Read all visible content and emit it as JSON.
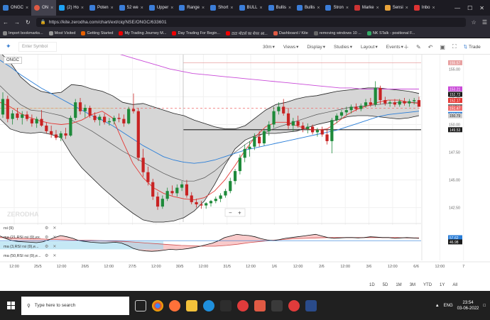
{
  "browser": {
    "tabs": [
      {
        "label": "ONGC",
        "color": "#387ed1",
        "ball": false,
        "active": false
      },
      {
        "label": "ON",
        "color": "#e05a44",
        "ball": true,
        "active": true
      },
      {
        "label": "(2) Ho",
        "color": "#1da1f2",
        "ball": false,
        "active": false
      },
      {
        "label": "Poten",
        "color": "#3b7dd8",
        "ball": false,
        "active": false
      },
      {
        "label": "52 we",
        "color": "#3b7dd8",
        "ball": false,
        "active": false
      },
      {
        "label": "Upper",
        "color": "#3b7dd8",
        "ball": false,
        "active": false
      },
      {
        "label": "Range",
        "color": "#3b7dd8",
        "ball": false,
        "active": false
      },
      {
        "label": "Short",
        "color": "#3b7dd8",
        "ball": false,
        "active": false
      },
      {
        "label": "BULL",
        "color": "#3b7dd8",
        "ball": false,
        "active": false
      },
      {
        "label": "Bullis",
        "color": "#3b7dd8",
        "ball": false,
        "active": false
      },
      {
        "label": "Bullis",
        "color": "#3b7dd8",
        "ball": false,
        "active": false
      },
      {
        "label": "Stron",
        "color": "#3b7dd8",
        "ball": false,
        "active": false
      },
      {
        "label": "Marke",
        "color": "#c33",
        "ball": false,
        "active": false
      },
      {
        "label": "Sensi",
        "color": "#e8a33a",
        "ball": false,
        "active": false
      },
      {
        "label": "Inbo",
        "color": "#d33",
        "ball": false,
        "active": false
      }
    ],
    "url": "https://kite.zerodha.com/chart/ext/ciq/NSE/ONGC/633601",
    "bookmarks": [
      {
        "label": "Import bookmarks...",
        "color": "#888"
      },
      {
        "label": "Most Visited",
        "color": "#999"
      },
      {
        "label": "Getting Started",
        "color": "#e66000"
      },
      {
        "label": "My Trading Journey M...",
        "color": "#e00"
      },
      {
        "label": "Day Trading For Begin...",
        "color": "#e00"
      },
      {
        "label": "टाटा मोटर्स का शेयर आ...",
        "color": "#e00"
      },
      {
        "label": "Dashboard / Kite",
        "color": "#e05a44"
      },
      {
        "label": "removing windows 10 ...",
        "color": "#666"
      },
      {
        "label": "NK STalk - positional F...",
        "color": "#3a6"
      }
    ]
  },
  "toolbar": {
    "search_placeholder": "Enter Symbol",
    "interval": "30m",
    "views": "Views",
    "display": "Display",
    "studies": "Studies",
    "layout": "Layout",
    "events": "Events",
    "trade": "Trade"
  },
  "symbol": "ONGC",
  "watermark": "ZERODHA",
  "indicators": [
    "rsi (9)",
    "ma (21,RSI rsi (9),ex...",
    "ma (3,RSI rsi (9),e...",
    "ma (50,RSI rsi (9),e..."
  ],
  "ranges": [
    "1D",
    "5D",
    "1M",
    "3M",
    "YTD",
    "1Y",
    "All"
  ],
  "taskbar": {
    "search_placeholder": "Type here to search",
    "lang": "ENG",
    "time": "23:54",
    "date": "03-06-2022"
  },
  "chart_data": {
    "type": "candlestick",
    "symbol": "ONGC",
    "interval": "30m",
    "ylim": [
      141.2,
      156.3
    ],
    "price_ticks": [
      155.0,
      152.5,
      150.0,
      147.5,
      145.0,
      142.5
    ],
    "price_labels": [
      {
        "value": 155.57,
        "color": "#e8a0a0"
      },
      {
        "value": 153.21,
        "color": "#c94ad8"
      },
      {
        "value": 152.72,
        "color": "#1a1a1a"
      },
      {
        "value": 152.17,
        "color": "#e53935"
      },
      {
        "value": 151.6,
        "color": "#777777"
      },
      {
        "value": 151.47,
        "color": "#ef6c6c"
      },
      {
        "value": 150.91,
        "color": "#2a7ed8"
      },
      {
        "value": 149.53,
        "color": "#1a1a1a"
      },
      {
        "value": 150.79,
        "color": "#cccccc"
      }
    ],
    "horizontal_levels": [
      155.57,
      149.53,
      151.47
    ],
    "x_labels": [
      "12:00",
      "25/5",
      "12:00",
      "26/5",
      "12:00",
      "27/5",
      "12:00",
      "30/5",
      "12:00",
      "31/5",
      "12:00",
      "1/6",
      "12:00",
      "2/6",
      "12:00",
      "3/6",
      "12:00",
      "6/6",
      "12:00",
      "7"
    ],
    "candles": [
      [
        150.9,
        152.9,
        150.6,
        152.3
      ],
      [
        152.3,
        152.6,
        150.2,
        150.5
      ],
      [
        150.5,
        151.3,
        150.0,
        151.0
      ],
      [
        151.0,
        151.5,
        150.4,
        150.6
      ],
      [
        150.6,
        151.2,
        150.0,
        150.9
      ],
      [
        150.9,
        151.2,
        150.3,
        150.5
      ],
      [
        150.5,
        150.9,
        149.8,
        150.1
      ],
      [
        150.1,
        150.7,
        149.7,
        150.5
      ],
      [
        150.5,
        151.3,
        149.8,
        149.9
      ],
      [
        149.9,
        150.2,
        149.2,
        149.4
      ],
      [
        149.4,
        149.9,
        148.8,
        149.1
      ],
      [
        149.1,
        149.5,
        148.6,
        148.8
      ],
      [
        148.8,
        149.4,
        148.5,
        149.2
      ],
      [
        149.2,
        149.7,
        148.7,
        149.0
      ],
      [
        149.0,
        150.8,
        148.9,
        150.6
      ],
      [
        150.6,
        152.3,
        150.4,
        152.0
      ],
      [
        152.0,
        152.4,
        150.9,
        151.2
      ],
      [
        151.2,
        151.8,
        150.6,
        151.5
      ],
      [
        151.5,
        151.7,
        150.6,
        150.8
      ],
      [
        150.8,
        151.1,
        150.2,
        150.4
      ],
      [
        150.4,
        150.9,
        149.9,
        150.7
      ],
      [
        150.7,
        151.0,
        150.0,
        150.2
      ],
      [
        150.2,
        150.6,
        149.9,
        150.3
      ],
      [
        150.3,
        150.8,
        150.0,
        150.6
      ],
      [
        150.6,
        151.0,
        150.2,
        150.5
      ],
      [
        150.5,
        150.9,
        149.8,
        150.1
      ],
      [
        150.1,
        151.6,
        150.0,
        151.4
      ],
      [
        151.4,
        152.8,
        151.0,
        151.2
      ],
      [
        151.2,
        151.5,
        146.7,
        147.0
      ],
      [
        147.0,
        147.8,
        145.3,
        145.7
      ],
      [
        145.7,
        146.2,
        144.5,
        144.8
      ],
      [
        144.8,
        145.1,
        143.2,
        143.5
      ],
      [
        143.5,
        143.9,
        142.3,
        142.6
      ],
      [
        142.6,
        143.6,
        142.4,
        143.3
      ],
      [
        143.3,
        144.3,
        143.1,
        144.0
      ],
      [
        144.0,
        144.5,
        143.6,
        143.8
      ],
      [
        143.8,
        144.6,
        143.5,
        144.3
      ],
      [
        144.3,
        144.9,
        144.0,
        144.6
      ],
      [
        144.6,
        145.0,
        143.4,
        143.6
      ],
      [
        143.6,
        143.9,
        142.8,
        143.0
      ],
      [
        143.0,
        143.3,
        142.5,
        142.8
      ],
      [
        142.8,
        143.1,
        142.4,
        142.7
      ],
      [
        142.7,
        143.0,
        142.4,
        142.9
      ],
      [
        142.9,
        143.2,
        142.6,
        143.1
      ],
      [
        143.1,
        143.5,
        142.9,
        143.3
      ],
      [
        143.3,
        143.8,
        143.0,
        143.6
      ],
      [
        143.6,
        144.2,
        143.4,
        144.0
      ],
      [
        144.0,
        145.2,
        143.8,
        144.9
      ],
      [
        144.9,
        146.0,
        144.6,
        145.8
      ],
      [
        145.8,
        147.3,
        145.5,
        147.0
      ],
      [
        147.0,
        148.2,
        146.6,
        147.8
      ],
      [
        147.8,
        148.5,
        147.1,
        148.0
      ],
      [
        148.0,
        149.2,
        147.7,
        148.9
      ],
      [
        148.9,
        149.4,
        148.0,
        148.3
      ],
      [
        148.3,
        149.6,
        148.1,
        149.4
      ],
      [
        149.4,
        150.3,
        149.0,
        150.0
      ],
      [
        150.0,
        151.6,
        149.7,
        151.2
      ],
      [
        151.2,
        152.0,
        150.9,
        151.6
      ],
      [
        151.6,
        152.3,
        150.8,
        151.0
      ],
      [
        151.0,
        151.5,
        149.6,
        149.9
      ],
      [
        149.9,
        150.6,
        149.4,
        150.3
      ],
      [
        150.3,
        150.8,
        149.7,
        149.9
      ],
      [
        149.9,
        150.2,
        149.3,
        149.6
      ],
      [
        149.6,
        150.1,
        149.2,
        149.8
      ],
      [
        149.8,
        150.0,
        149.1,
        149.3
      ],
      [
        149.3,
        149.7,
        148.9,
        149.5
      ],
      [
        149.5,
        149.8,
        148.9,
        149.1
      ],
      [
        149.1,
        149.6,
        148.2,
        148.5
      ],
      [
        148.5,
        150.6,
        147.4,
        150.4
      ],
      [
        150.4,
        151.0,
        150.1,
        150.8
      ],
      [
        150.8,
        151.3,
        150.5,
        151.1
      ],
      [
        151.1,
        151.6,
        150.8,
        151.3
      ],
      [
        151.3,
        151.8,
        151.0,
        151.6
      ],
      [
        151.6,
        151.9,
        151.2,
        151.4
      ],
      [
        151.4,
        151.9,
        151.2,
        151.7
      ],
      [
        151.7,
        152.3,
        151.5,
        152.0
      ],
      [
        152.0,
        152.4,
        151.6,
        151.8
      ],
      [
        151.8,
        153.9,
        151.6,
        153.3
      ],
      [
        153.3,
        153.5,
        151.8,
        152.2
      ],
      [
        152.2,
        152.5,
        151.7,
        151.9
      ],
      [
        151.9,
        152.2,
        151.6,
        152.0
      ],
      [
        152.0,
        152.3,
        151.6,
        151.8
      ],
      [
        151.8,
        152.3,
        151.6,
        152.1
      ],
      [
        152.1,
        152.4,
        151.7,
        151.9
      ],
      [
        151.9,
        152.3,
        151.6,
        152.1
      ],
      [
        152.1,
        152.4,
        151.8,
        152.2
      ],
      [
        152.2,
        152.5,
        151.6,
        151.6
      ]
    ],
    "bollinger_upper": [
      156.5,
      155.6,
      154.3,
      153.5,
      153.0,
      152.8,
      152.9,
      153.6,
      153.5,
      153.2,
      153.0,
      152.6,
      152.0,
      151.8,
      151.9,
      151.6,
      151.3,
      151.0,
      150.8,
      150.4,
      150.1,
      149.8,
      149.6,
      149.6,
      149.9,
      150.6,
      151.3,
      151.8,
      152.0,
      152.3,
      152.5,
      152.6,
      152.8,
      153.0,
      153.1,
      153.2,
      153.3,
      153.3,
      153.2,
      153.1,
      153.0,
      152.8
    ],
    "bollinger_middle": [
      153.5,
      152.6,
      151.8,
      151.3,
      151.2,
      151.0,
      150.8,
      150.4,
      149.9,
      149.4,
      148.8,
      148.2,
      147.6,
      147.1,
      146.6,
      146.1,
      145.6,
      145.2,
      144.9,
      144.9,
      145.2,
      145.8,
      146.6,
      147.5,
      148.2,
      148.8,
      149.3,
      149.7,
      150.0,
      150.3,
      150.6,
      150.9,
      151.1,
      151.3,
      151.5,
      151.6,
      151.7,
      151.8,
      151.9,
      152.0,
      152.0,
      152.0
    ],
    "bollinger_lower": [
      150.5,
      149.6,
      149.3,
      149.2,
      149.3,
      149.1,
      148.8,
      147.3,
      146.1,
      145.2,
      144.3,
      143.5,
      142.7,
      142.0,
      141.4,
      141.2,
      141.2,
      141.3,
      141.6,
      142.2,
      143.1,
      144.6,
      146.3,
      147.8,
      148.6,
      149.0,
      149.2,
      149.2,
      149.3,
      149.4,
      149.7,
      150.0,
      150.2,
      150.4,
      150.7,
      150.8,
      150.8,
      150.7,
      150.6,
      150.5,
      150.6,
      150.8
    ],
    "ma_red": [
      152.0,
      151.6,
      151.0,
      150.6,
      150.3,
      150.1,
      150.0,
      150.1,
      150.4,
      150.9,
      151.2,
      150.6,
      148.5,
      146.5,
      145.2,
      144.3,
      143.8,
      143.5,
      143.3,
      143.2,
      143.4,
      144.0,
      145.0,
      146.3,
      147.7,
      148.9,
      149.8,
      150.2,
      150.2,
      149.9,
      149.6,
      149.5,
      149.6,
      150.2,
      150.9,
      151.4,
      151.7,
      152.0,
      152.2,
      152.2,
      152.0,
      151.9
    ],
    "ma_blue": [
      155.8,
      155.2,
      154.5,
      153.9,
      153.3,
      152.8,
      152.3,
      151.8,
      151.3,
      150.8,
      150.4,
      149.9,
      149.3,
      148.7,
      148.1,
      147.6,
      147.1,
      146.8,
      146.6,
      146.5,
      146.6,
      146.8,
      147.1,
      147.4,
      147.7,
      147.9,
      148.1,
      148.3,
      148.5,
      148.7,
      148.9,
      149.1,
      149.3,
      149.5,
      149.8,
      150.1,
      150.4,
      150.7,
      150.9,
      151.0,
      151.1,
      151.2
    ],
    "ma_magenta": [
      156.5,
      156.2,
      155.9,
      155.6,
      155.3,
      155.0,
      154.8,
      154.6,
      154.5,
      154.4,
      154.3,
      154.2,
      154.1,
      154.0,
      153.9,
      153.8,
      153.7,
      153.6,
      153.5,
      153.4,
      153.3,
      153.3,
      153.2,
      153.2,
      153.2,
      153.2,
      153.2,
      153.2
    ],
    "rsi_ticks": [
      57.62,
      46.98
    ],
    "rsi": [
      62,
      55,
      50,
      48,
      47,
      46,
      45,
      47,
      52,
      58,
      63,
      60,
      56,
      50,
      48,
      46,
      45,
      44,
      45,
      46,
      44,
      38,
      30,
      26,
      24,
      23,
      24,
      26,
      28,
      27,
      28,
      30,
      33,
      36,
      40,
      44,
      50,
      58,
      62,
      66,
      64,
      63,
      60,
      55,
      52,
      50,
      53,
      56,
      58,
      60,
      62,
      64,
      66,
      62,
      58,
      56,
      57,
      58,
      58,
      57,
      58,
      60,
      59,
      58,
      58,
      56,
      57,
      58,
      57,
      56
    ],
    "rsi_ma21": [
      58,
      57,
      56,
      55,
      54,
      53,
      52,
      51,
      51,
      50,
      49,
      48,
      46,
      44,
      42,
      40,
      38,
      37,
      36,
      36,
      38,
      41,
      45,
      48,
      51,
      53,
      55,
      56,
      57,
      58,
      58,
      58,
      58,
      58,
      58,
      58,
      57,
      57
    ]
  }
}
